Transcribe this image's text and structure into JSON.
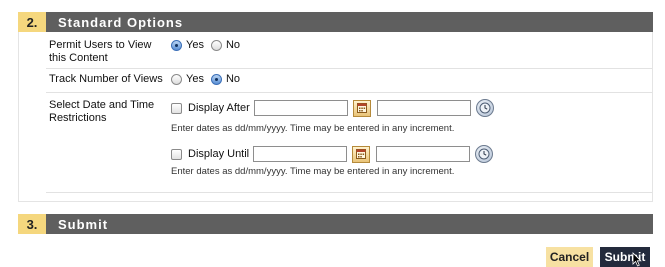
{
  "standard_options": {
    "number": "2.",
    "title": "Standard Options",
    "permit": {
      "label_line1": "Permit Users to View",
      "label_line2": "this Content",
      "yes": "Yes",
      "no": "No",
      "selected": "Yes"
    },
    "track": {
      "label": "Track Number of Views",
      "yes": "Yes",
      "no": "No",
      "selected": "No"
    },
    "date_restrictions": {
      "label_line1": "Select Date and Time",
      "label_line2": "Restrictions",
      "display_after": {
        "label": "Display After",
        "date_value": "",
        "time_value": "",
        "checked": false,
        "hint": "Enter dates as dd/mm/yyyy. Time may be entered in any increment."
      },
      "display_until": {
        "label": "Display Until",
        "date_value": "",
        "time_value": "",
        "checked": false,
        "hint": "Enter dates as dd/mm/yyyy. Time may be entered in any increment."
      }
    }
  },
  "submit_section": {
    "number": "3.",
    "title": "Submit",
    "cancel_label": "Cancel",
    "submit_label": "Submit"
  },
  "colors": {
    "header_bar": "#5f5f5f",
    "number_box": "#f5d77e",
    "cancel_bg": "#f7e1a2",
    "submit_bg": "#232a3c"
  },
  "icons": {
    "calendar": "calendar-icon",
    "clock": "clock-icon",
    "cursor": "mouse-cursor-icon"
  }
}
